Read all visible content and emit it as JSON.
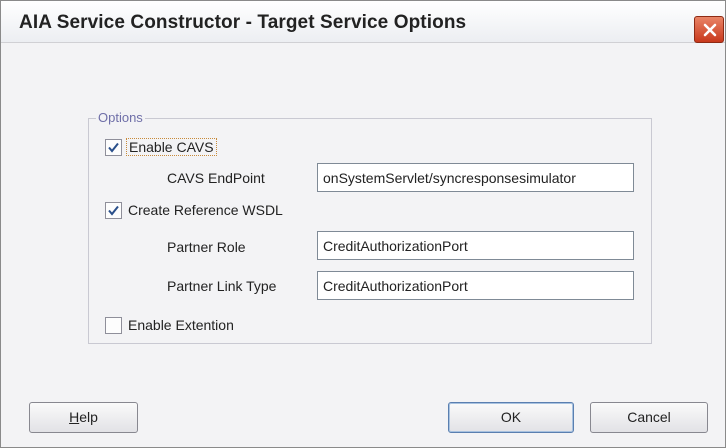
{
  "window": {
    "title": "AIA Service Constructor - Target Service Options"
  },
  "options": {
    "legend": "Options",
    "enable_cavs": {
      "label": "Enable CAVS",
      "checked": true
    },
    "cavs_endpoint": {
      "label": "CAVS EndPoint",
      "value": "onSystemServlet/syncresponsesimulator"
    },
    "create_reference_wsdl": {
      "label": "Create Reference WSDL",
      "checked": true
    },
    "partner_role": {
      "label": "Partner Role",
      "value": "CreditAuthorizationPort"
    },
    "partner_link_type": {
      "label": "Partner Link Type",
      "value": "CreditAuthorizationPort"
    },
    "enable_extention": {
      "label": "Enable Extention",
      "checked": false
    }
  },
  "buttons": {
    "help_mnemonic": "H",
    "help_rest": "elp",
    "ok": "OK",
    "cancel": "Cancel"
  },
  "colors": {
    "close_button": "#d0482a",
    "legend_text": "#6f6fa8",
    "check_mark": "#2a4f8a"
  },
  "icons": {
    "close": "close-icon",
    "check": "check-icon"
  }
}
